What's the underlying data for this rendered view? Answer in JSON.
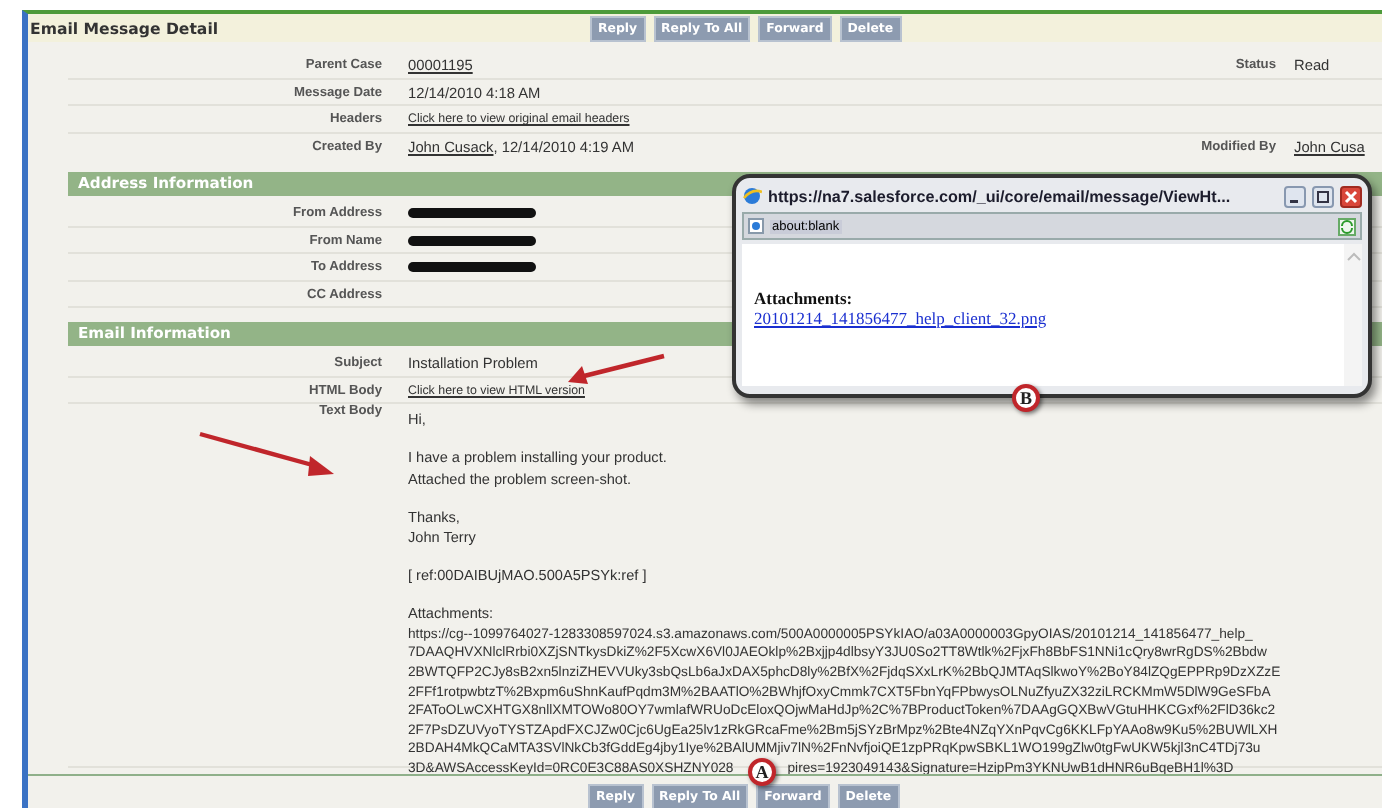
{
  "header": {
    "title": "Email Message Detail",
    "buttons": [
      "Reply",
      "Reply To All",
      "Forward",
      "Delete"
    ]
  },
  "fields": [
    {
      "label": "Parent Case",
      "value": "00001195",
      "kind": "link",
      "side": {
        "label": "Status",
        "value": "Read",
        "kind": "text"
      }
    },
    {
      "label": "Message Date",
      "value": "12/14/2010 4:18 AM",
      "kind": "text"
    },
    {
      "label": "Headers",
      "value": "Click here to view original email headers",
      "kind": "small-link"
    },
    {
      "label": "Created By",
      "value": "John Cusack",
      "suffix": ", 12/14/2010 4:19 AM",
      "kind": "link",
      "side": {
        "label": "Modified By",
        "value": "John Cusa",
        "kind": "link"
      }
    }
  ],
  "sections": [
    {
      "title": "Address Information",
      "fields": [
        {
          "label": "From Address",
          "kind": "redacted"
        },
        {
          "label": "From Name",
          "kind": "redacted"
        },
        {
          "label": "To Address",
          "kind": "redacted"
        },
        {
          "label": "CC Address",
          "kind": "empty"
        }
      ]
    },
    {
      "title": "Email Information",
      "fields": [
        {
          "label": "Subject",
          "value": "Installation Problem",
          "kind": "text"
        },
        {
          "label": "HTML Body",
          "value": "Click here to view HTML version",
          "kind": "small-link"
        },
        {
          "label": "Text Body",
          "kind": "body",
          "paragraphs": [
            [
              "Hi,"
            ],
            [
              "I have a problem installing your product.",
              "Attached the problem screen-shot."
            ],
            [
              "Thanks,",
              "John Terry"
            ],
            [
              "[ ref:00DAIBUjMAO.500A5PSYk:ref ]"
            ],
            [
              "Attachments:",
              "https://cg--1099764027-1283308597024.s3.amazonaws.com/500A0000005PSYkIAO/a03A0000003GpyOIAS/20101214_141856477_help_",
              "7DAAQHVXNlclRrbi0XZjSNTkysDkiZ%2F5XcwX6Vl0JAEOklp%2Bxjjp4dlbsyY3JU0So2TT8Wtlk%2FjxFh8BbFS1NNi1cQry8wrRgDS%2Bbdw",
              "2BWTQFP2CJy8sB2xn5lnziZHEVVUky3sbQsLb6aJxDAX5phcD8ly%2BfX%2FjdqSXxLrK%2BbQJMTAqSlkwoY%2BoY84lZQgEPPRp9DzXZzE",
              "2FFf1rotpwbtzT%2Bxpm6uShnKaufPqdm3M%2BAATlO%2BWhjfOxyCmmk7CXT5FbnYqFPbwysOLNuZfyuZX32ziLRCKMmW5DlW9GeSFbA",
              "2FAToOLwCXHTGX8nllXMTOWo80OY7wmlafWRUoDcEloxQOjwMaHdJp%2C%7BProductToken%7DAAgGQXBwVGtuHHKCGxf%2FlD36kc2",
              "2F7PsDZUVyoTYSTZApdFXCJZw0Cjc6UgEa25lv1zRkGRcaFme%2Bm5jSYzBrMpz%2Bte4NZqYXnPqvCg6KKLFpYAAo8w9Ku5%2BUWlLXH",
              "2BDAH4MkQCaMTA3SVlNkCb3fGddEg4jby1Iye%2BAlUMMjiv7lN%2FnNvfjoiQE1zpPRqKpwSBKL1WO199gZlw0tgFwUKW5kjl3nC4TDj73u",
              [
                "3D&AWSAccessKeyId=0RC0E3C88AS0XSHZNY028",
                "pires=1923049143&Signature=HzipPm3YKNUwB1dHNR6uBqeBH1l%3D"
              ]
            ]
          ]
        }
      ]
    }
  ],
  "footer_buttons": [
    "Reply",
    "Reply To All",
    "Forward",
    "Delete"
  ],
  "popup": {
    "title": "https://na7.salesforce.com/_ui/core/email/message/ViewHt...",
    "address": "about:blank",
    "heading": "Attachments:",
    "link": "20101214_141856477_help_client_32.png"
  },
  "annotations": [
    {
      "label": "A"
    },
    {
      "label": "B"
    }
  ]
}
